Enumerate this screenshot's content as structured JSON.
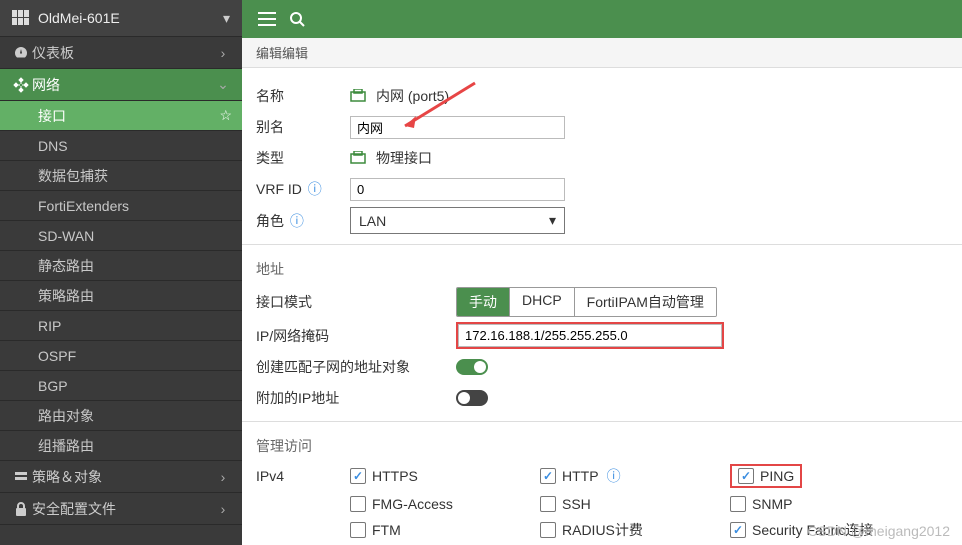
{
  "header": {
    "device": "OldMei-601E"
  },
  "sidebar": {
    "dashboard": "仪表板",
    "network": "网络",
    "subs": {
      "iface": "接口",
      "dns": "DNS",
      "pcap": "数据包捕获",
      "fext": "FortiExtenders",
      "sdwan": "SD-WAN",
      "sroute": "静态路由",
      "proute": "策略路由",
      "rip": "RIP",
      "ospf": "OSPF",
      "bgp": "BGP",
      "robj": "路由对象",
      "mcast": "组播路由"
    },
    "policy": "策略＆对象",
    "security": "安全配置文件"
  },
  "breadcrumb": "编辑编辑",
  "form": {
    "name_label": "名称",
    "name_value": "内网 (port5)",
    "alias_label": "别名",
    "alias_value": "内网",
    "type_label": "类型",
    "type_value": "物理接口",
    "vrf_label": "VRF ID",
    "vrf_value": "0",
    "role_label": "角色",
    "role_value": "LAN"
  },
  "addr": {
    "section": "地址",
    "mode_label": "接口模式",
    "modes": {
      "manual": "手动",
      "dhcp": "DHCP",
      "fortiipam": "FortiIPAM自动管理"
    },
    "ipmask_label": "IP/网络掩码",
    "ipmask_value": "172.16.188.1/255.255.255.0",
    "subnet_label": "创建匹配子网的地址对象",
    "extra_ip_label": "附加的IP地址"
  },
  "access": {
    "section": "管理访问",
    "ipv4": "IPv4",
    "https": "HTTPS",
    "http": "HTTP",
    "ping": "PING",
    "fmg": "FMG-Access",
    "ssh": "SSH",
    "snmp": "SNMP",
    "ftm": "FTM",
    "radius": "RADIUS计费",
    "secfab": "Security Fabric连接"
  },
  "watermark": "CSDN @meigang2012"
}
